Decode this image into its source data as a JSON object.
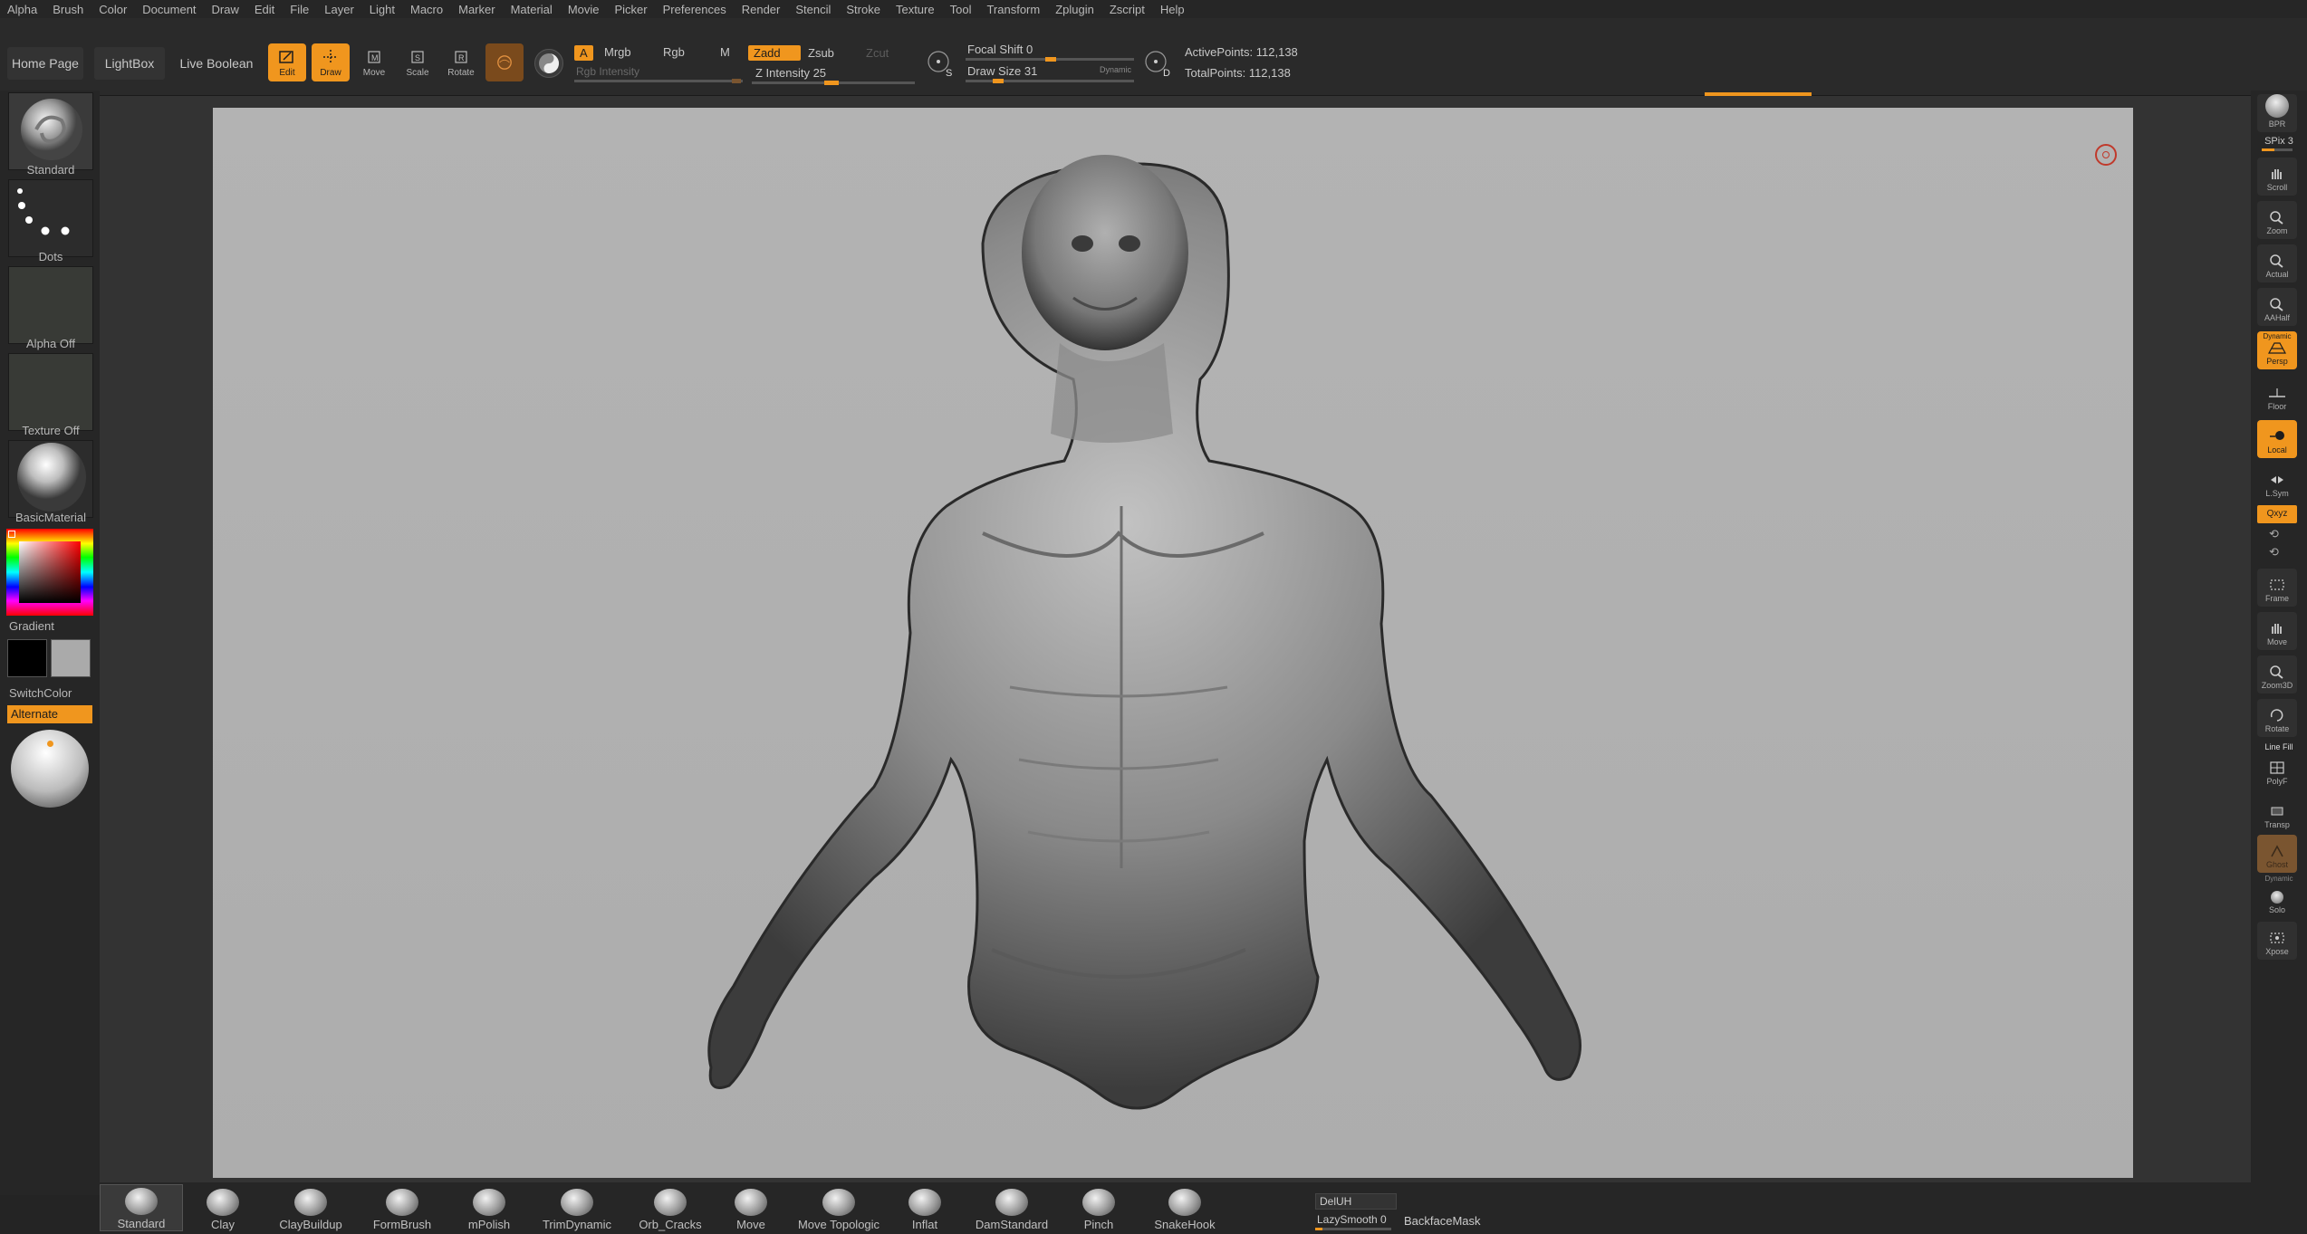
{
  "menu": [
    "Alpha",
    "Brush",
    "Color",
    "Document",
    "Draw",
    "Edit",
    "File",
    "Layer",
    "Light",
    "Macro",
    "Marker",
    "Material",
    "Movie",
    "Picker",
    "Preferences",
    "Render",
    "Stencil",
    "Stroke",
    "Texture",
    "Tool",
    "Transform",
    "Zplugin",
    "Zscript",
    "Help"
  ],
  "toolbar": {
    "home_page": "Home Page",
    "lightbox": "LightBox",
    "live_boolean": "Live Boolean",
    "edit": "Edit",
    "draw": "Draw",
    "move": "Move",
    "scale": "Scale",
    "rotate": "Rotate",
    "a_label": "A",
    "mrgb": "Mrgb",
    "rgb": "Rgb",
    "m": "M",
    "rgb_intensity": "Rgb Intensity",
    "zadd": "Zadd",
    "zsub": "Zsub",
    "zcut": "Zcut",
    "z_intensity": "Z Intensity 25",
    "s_label": "S",
    "focal_shift": "Focal Shift 0",
    "draw_size": "Draw Size 31",
    "dynamic": "Dynamic",
    "d_label": "D",
    "active_points": "ActivePoints: 112,138",
    "total_points": "TotalPoints: 112,138"
  },
  "left_panel": {
    "brush_label": "Standard",
    "stroke_label": "Dots",
    "alpha_label": "Alpha Off",
    "texture_label": "Texture Off",
    "material_label": "BasicMaterial",
    "gradient_label": "Gradient",
    "switchcolor_label": "SwitchColor",
    "alternate_label": "Alternate"
  },
  "right_shelf": {
    "bpr": "BPR",
    "spix": "SPix 3",
    "scroll": "Scroll",
    "zoom": "Zoom",
    "actual": "Actual",
    "aahalf": "AAHalf",
    "dynamic_label": "Dynamic",
    "persp": "Persp",
    "floor": "Floor",
    "local": "Local",
    "lsym": "L.Sym",
    "xyz": "Qxyz",
    "frame": "Frame",
    "move": "Move",
    "zoom3d": "Zoom3D",
    "rotate": "Rotate",
    "line_fill": "Line Fill",
    "polyf": "PolyF",
    "transp": "Transp",
    "ghost": "Ghost",
    "dynamic2": "Dynamic",
    "solo": "Solo",
    "xpose": "Xpose"
  },
  "brushes": [
    "Standard",
    "Clay",
    "ClayBuildup",
    "FormBrush",
    "mPolish",
    "TrimDynamic",
    "Orb_Cracks",
    "Move",
    "Move Topologic",
    "Inflat",
    "DamStandard",
    "Pinch",
    "SnakeHook"
  ],
  "bottom_right": {
    "deluh": "DelUH",
    "lazy_smooth": "LazySmooth 0",
    "backface_mask": "BackfaceMask"
  },
  "colors": {
    "accent": "#f0961e",
    "canvas": "#b0b0b0",
    "panel": "#262626"
  }
}
